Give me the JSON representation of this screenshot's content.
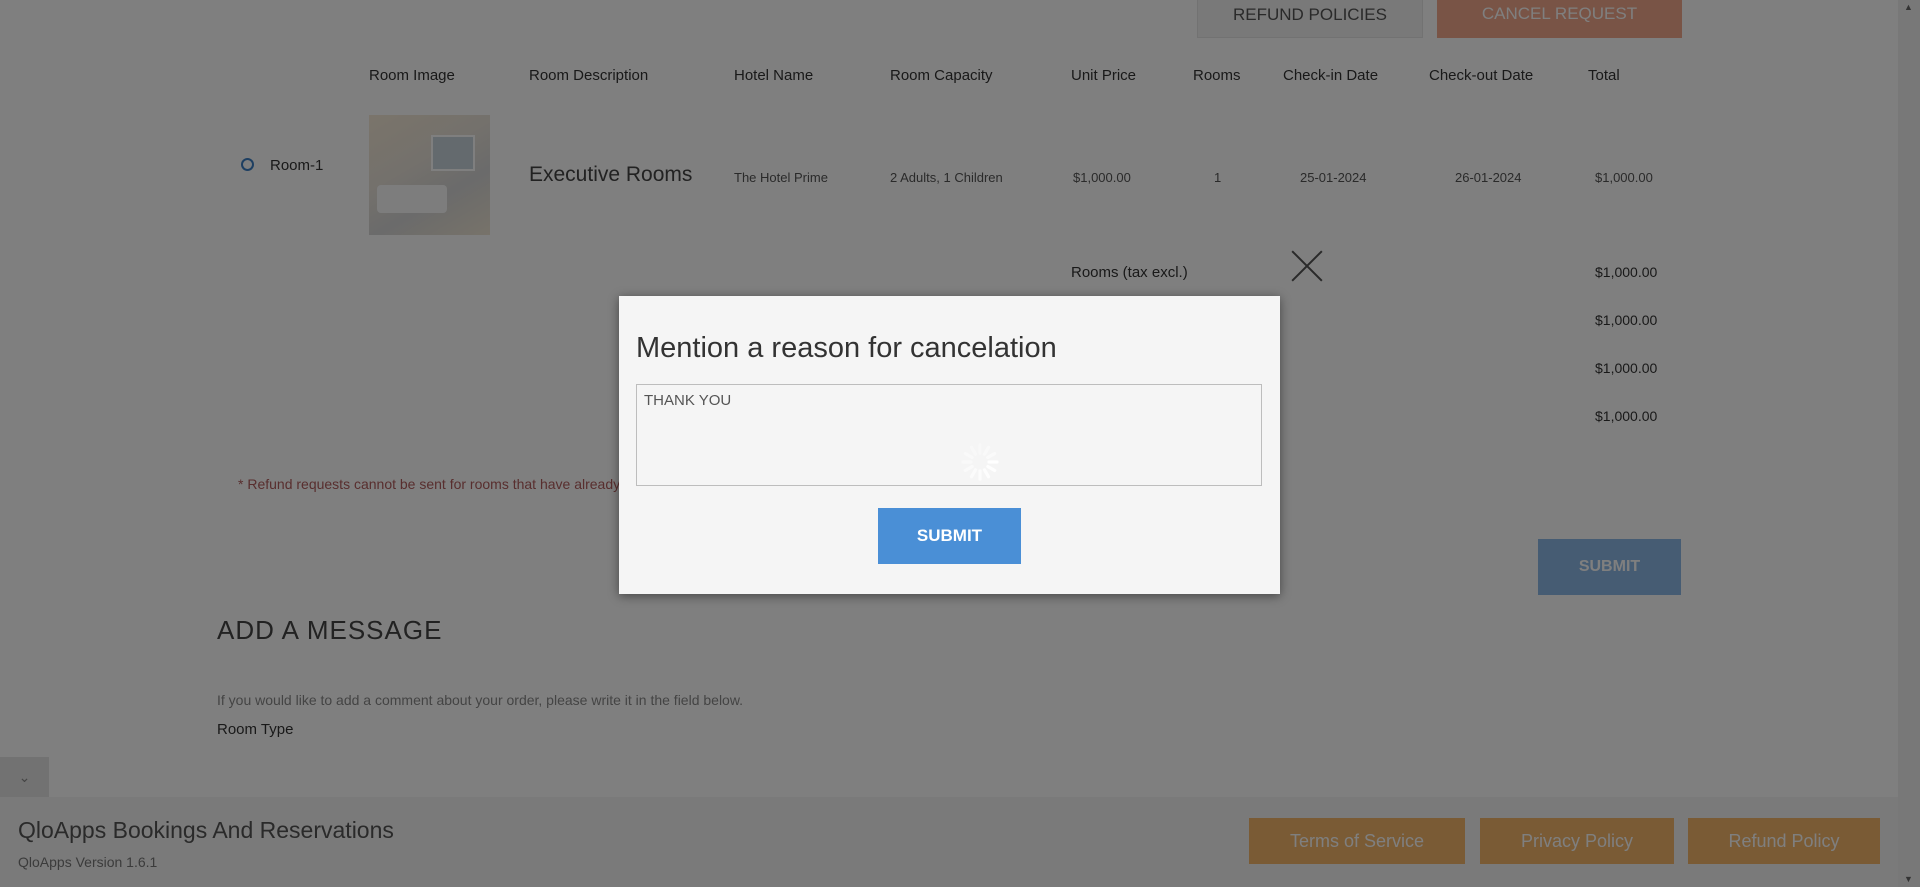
{
  "page": {
    "top_buttons": {
      "policies": "REFUND POLICIES",
      "cancel_request": "CANCEL REQUEST"
    },
    "table_headers": [
      "Room Image",
      "Room Description",
      "Hotel Name",
      "Room Capacity",
      "Unit Price",
      "Rooms",
      "Check-in Date",
      "Check-out Date",
      "Total"
    ],
    "room": {
      "select_label": "Room-1",
      "description": "Executive Rooms",
      "hotel_name": "The Hotel Prime",
      "capacity": "2 Adults, 1 Children",
      "unit_price": "$1,000.00",
      "rooms": "1",
      "checkin": "25-01-2024",
      "checkout": "26-01-2024",
      "total": "$1,000.00"
    },
    "totals": {
      "label": "Rooms (tax excl.)",
      "values": [
        "$1,000.00",
        "$1,000.00",
        "$1,000.00",
        "$1,000.00"
      ]
    },
    "note": "* Refund requests cannot be sent for rooms that have already been refunded or are currently being processed.",
    "submit_label": "SUBMIT",
    "add_message": {
      "heading": "ADD A MESSAGE",
      "help": "If you would like to add a comment about your order, please write it in the field below.",
      "room_type_label": "Room Type"
    },
    "collapse_icon": "chevron-down-icon",
    "footer": {
      "title": "QloApps Bookings And Reservations",
      "version": "QloApps Version 1.6.1",
      "buttons": [
        "Terms of Service",
        "Privacy Policy",
        "Refund Policy"
      ]
    }
  },
  "modal": {
    "title": "Mention a reason for cancelation",
    "reason_value": "THANK YOU",
    "submit_label": "SUBMIT",
    "close_icon": "close-icon",
    "spinner_icon": "loading-spinner-icon"
  },
  "colors": {
    "overlay": "rgba(0,0,0,0.5)",
    "submit_blue": "#4a8fd6",
    "cancel_request_orange": "#f3a98c",
    "footer_button_orange": "#f4b66a"
  }
}
